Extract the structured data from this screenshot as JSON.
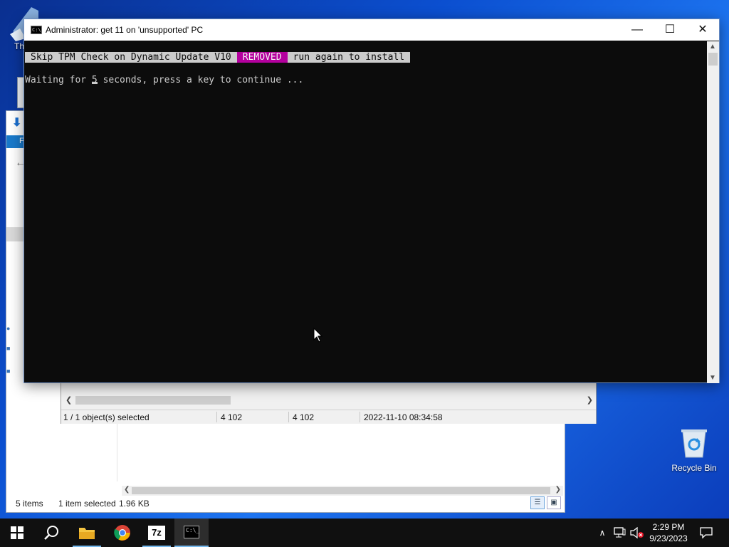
{
  "desktop": {
    "recycle_bin_label": "Recycle Bin",
    "partial_icon_label": "Th"
  },
  "explorer": {
    "ribbon_tab_initial": "F",
    "status": {
      "items": "5 items",
      "selected": "1 item selected",
      "size": "1.96 KB"
    }
  },
  "sevenzip": {
    "status": {
      "selection": "1 / 1 object(s) selected",
      "size": "4 102",
      "packed": "4 102",
      "modified": "2022-11-10 08:34:58"
    }
  },
  "console": {
    "title": "Administrator:  get 11 on 'unsupported' PC",
    "banner": {
      "label": "Skip TPM Check on Dynamic Update V10",
      "status": "REMOVED",
      "suffix": "run again to install"
    },
    "wait_prefix": "Waiting for 5",
    "wait_suffix": " seconds, press a key to continue ...",
    "colors": {
      "background": "#0c0c0c",
      "text": "#cccccc",
      "removed_bg": "#b4009e"
    }
  },
  "taskbar": {
    "apps": [
      {
        "name": "start",
        "icon": "windows-logo-icon"
      },
      {
        "name": "search",
        "icon": "search-icon"
      },
      {
        "name": "file-explorer",
        "icon": "folder-icon"
      },
      {
        "name": "chrome",
        "icon": "chrome-icon"
      },
      {
        "name": "7-zip",
        "icon": "sevenzip-icon",
        "label": "7z"
      },
      {
        "name": "command-prompt",
        "icon": "cmd-icon",
        "active": true
      }
    ],
    "time": "2:29 PM",
    "date": "9/23/2023"
  }
}
